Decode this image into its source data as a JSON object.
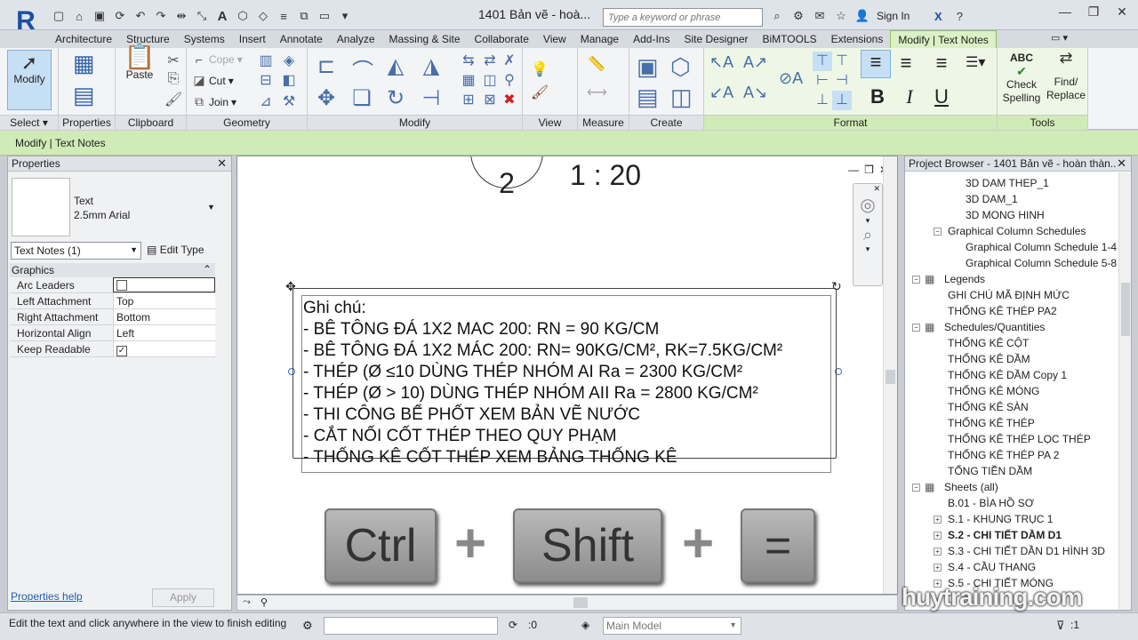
{
  "titlebar": {
    "app_logo": "R",
    "doc_title": "1401 Bản vẽ - hoà...",
    "search_placeholder": "Type a keyword or phrase",
    "sign_in": "Sign In"
  },
  "tabs": [
    "Architecture",
    "Structure",
    "Systems",
    "Insert",
    "Annotate",
    "Analyze",
    "Massing & Site",
    "Collaborate",
    "View",
    "Manage",
    "Add-Ins",
    "Site Designer",
    "BiMTOOLS",
    "Extensions",
    "Modify | Text Notes"
  ],
  "ribbon": {
    "modify": "Modify",
    "select": "Select",
    "properties": "Properties",
    "clipboard": "Clipboard",
    "paste": "Paste",
    "cope": "Cope",
    "cut": "Cut",
    "join": "Join",
    "geometry": "Geometry",
    "modify_panel": "Modify",
    "view_panel": "View",
    "measure": "Measure",
    "create": "Create",
    "format": "Format",
    "tools": "Tools",
    "check_spelling": [
      "Check",
      "Spelling"
    ],
    "find_replace": [
      "Find/",
      "Replace"
    ],
    "abc": "ABC",
    "bold": "B",
    "italic": "I",
    "underline": "U"
  },
  "context_bar": "Modify | Text Notes",
  "properties": {
    "title": "Properties",
    "type_name": "Text",
    "type_sub": "2.5mm Arial",
    "instance_select": "Text Notes (1)",
    "edit_type": "Edit Type",
    "section": "Graphics",
    "rows": [
      {
        "k": "Arc Leaders",
        "v": ""
      },
      {
        "k": "Left Attachment",
        "v": "Top"
      },
      {
        "k": "Right Attachment",
        "v": "Bottom"
      },
      {
        "k": "Horizontal Align",
        "v": "Left"
      },
      {
        "k": "Keep Readable",
        "v": "✓"
      }
    ],
    "help": "Properties help",
    "apply": "Apply"
  },
  "view": {
    "scale": "1 : 20",
    "section_num": "2",
    "lines": [
      "Ghi chú:",
      "- BÊ TÔNG ĐÁ 1X2 MAC 200: RN = 90 KG/CM",
      "- BÊ TÔNG ĐÁ 1X2 MÁC 200: RN= 90KG/CM², RK=7.5KG/CM²",
      "- THÉP (Ø ≤10 DÙNG THÉP NHÓM AI Ra = 2300 KG/CM²",
      "- THÉP (Ø > 10) DÙNG THÉP NHÓM AII Ra = 2800 KG/CM²",
      "- THI CÔNG BỂ PHỐT XEM BẢN VẼ NƯỚC",
      "- CẮT NỐI CỐT THÉP THEO QUY PHẠM",
      "- THỐNG KÊ CỐT THÉP XEM BẢNG THỐNG KÊ"
    ],
    "keys": [
      "Ctrl",
      "Shift",
      "="
    ],
    "plus": "+"
  },
  "browser": {
    "title": "Project Browser - 1401 Bản vẽ - hoàn thàn...",
    "items": [
      "3D DAM THEP_1",
      "3D DAM_1",
      "3D MONG HINH",
      "Graphical Column Schedules",
      "Graphical Column Schedule 1-4",
      "Graphical Column Schedule 5-8",
      "Legends",
      "GHI CHÚ MÃ ĐỊNH MỨC",
      "THỐNG KÊ THÉP PA2",
      "Schedules/Quantities",
      "THỐNG KÊ CỘT",
      "THỐNG KÊ DẦM",
      "THỐNG KÊ DẦM Copy 1",
      "THỐNG KÊ MÓNG",
      "THỐNG KÊ SÀN",
      "THỐNG KÊ THÉP",
      "THỐNG KÊ THÉP LỌC THÉP",
      "THỐNG KÊ THÉP PA 2",
      "TỔNG TIỀN DẦM",
      "Sheets (all)",
      "B.01 - BÌA HỒ SƠ",
      "S.1 - KHUNG TRỤC 1",
      "S.2 - CHI TIẾT DẦM D1",
      "S.3 - CHI TIẾT DẦN D1 HÌNH 3D",
      "S.4 - CẦU THANG",
      "S.5 - CHI TIẾT MÓNG"
    ]
  },
  "status": {
    "message": "Edit the text and click anywhere in the view to finish editing",
    "counter": ":0",
    "model": "Main Model",
    "filter": ":1"
  },
  "watermark": "huytraining.com",
  "colors": {
    "context_green": "#d0ebb7",
    "accent_blue": "#1b4fa3"
  }
}
